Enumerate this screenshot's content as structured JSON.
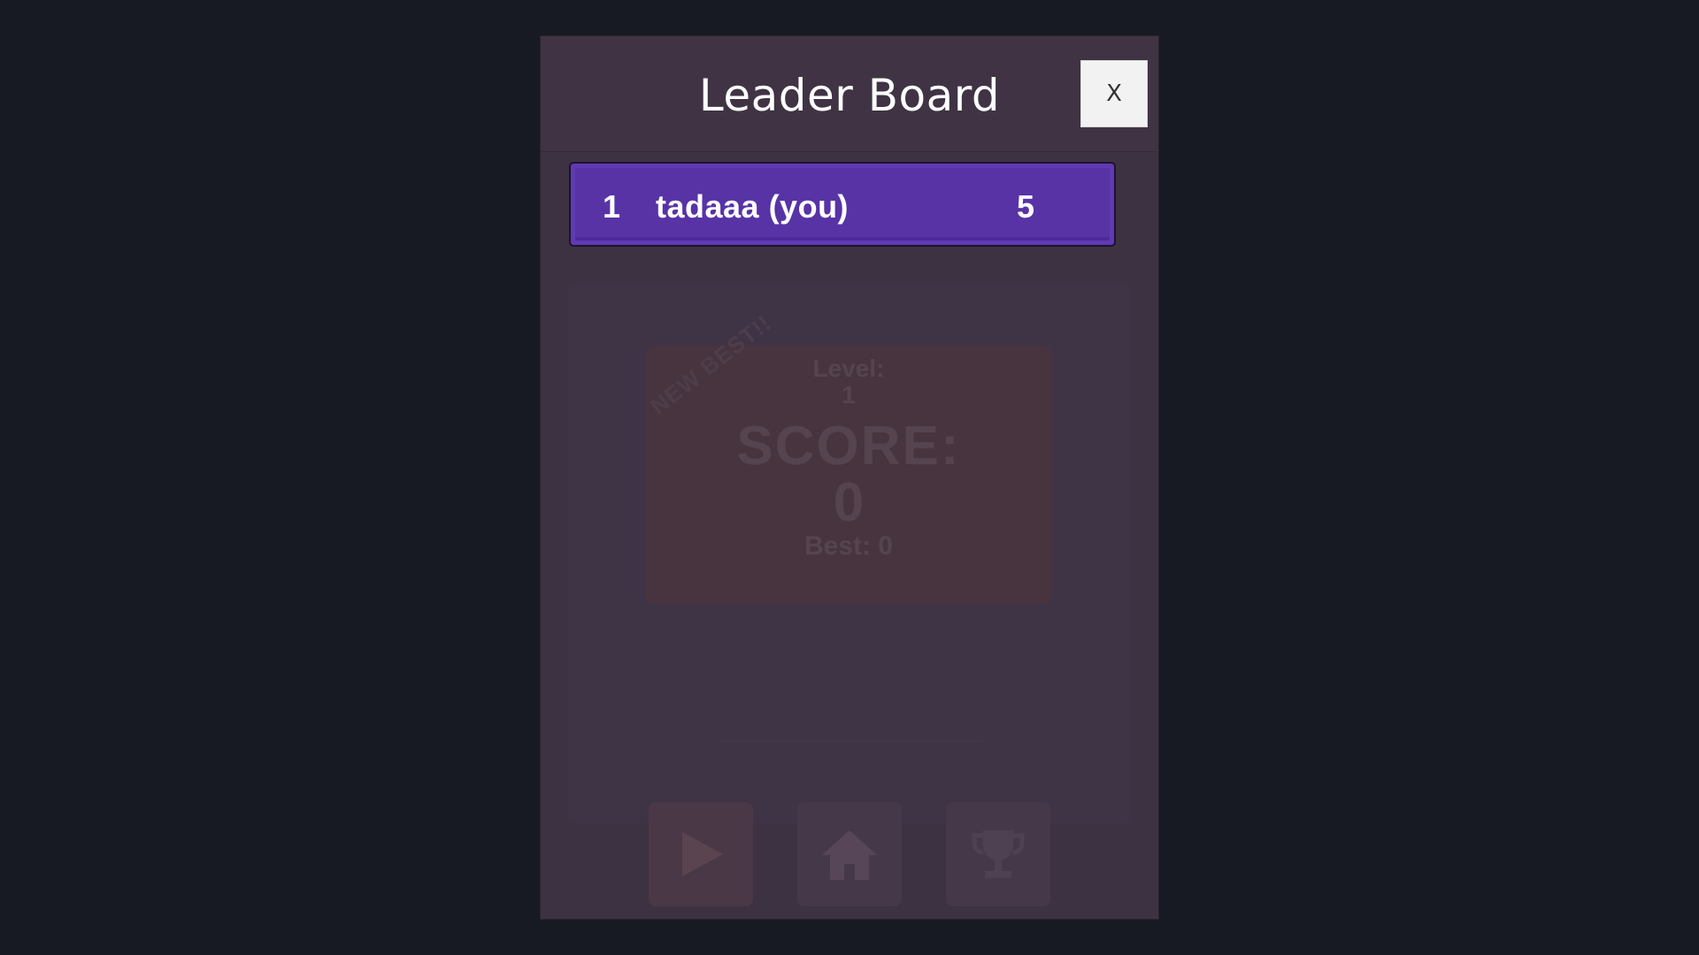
{
  "leaderboard": {
    "title": "Leader Board",
    "close_label": "X",
    "entries": [
      {
        "rank": "1",
        "name": "tadaaa (you)",
        "score": "5"
      }
    ]
  },
  "background_screen": {
    "new_best_label": "NEW BEST!!",
    "level_label": "Level:",
    "level_value": "1",
    "score_label": "SCORE:",
    "score_value": "0",
    "best_text": "Best: 0",
    "buttons": [
      {
        "icon": "play-icon"
      },
      {
        "icon": "home-icon"
      },
      {
        "icon": "trophy-icon"
      }
    ]
  },
  "colors": {
    "page_background": "#171a22",
    "frame_background": "#3d3242",
    "row_highlight": "#5733a6"
  }
}
